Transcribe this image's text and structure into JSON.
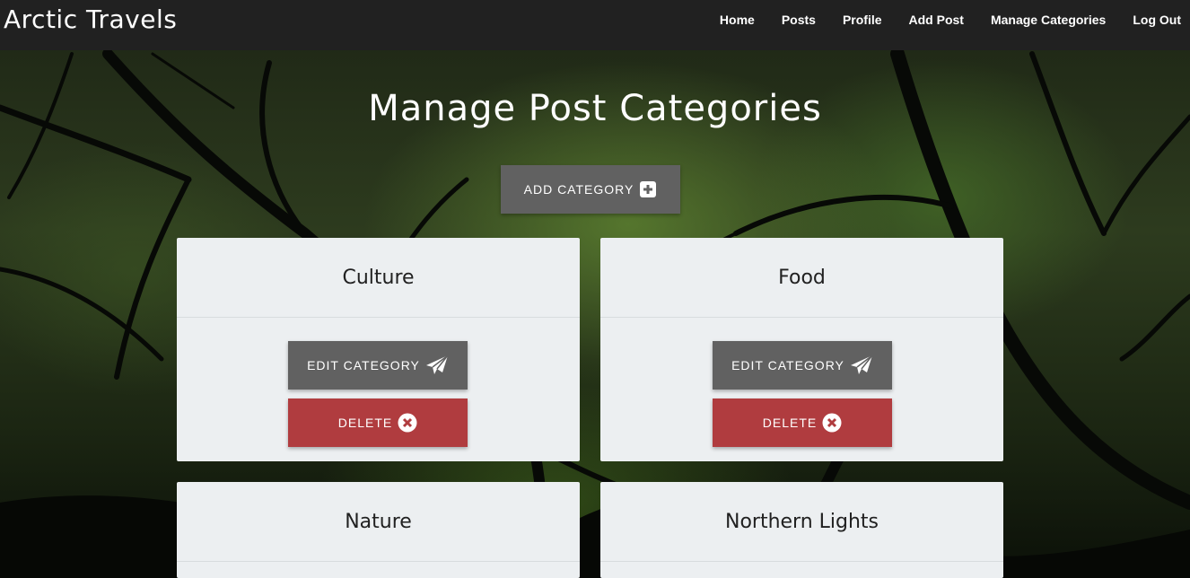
{
  "navbar": {
    "brand": "Arctic Travels",
    "links": [
      "Home",
      "Posts",
      "Profile",
      "Add Post",
      "Manage Categories",
      "Log Out"
    ]
  },
  "page": {
    "title": "Manage Post Categories",
    "add_button": "Add Category"
  },
  "categories": [
    {
      "name": "Culture",
      "edit": "Edit Category",
      "delete": "Delete"
    },
    {
      "name": "Food",
      "edit": "Edit Category",
      "delete": "Delete"
    },
    {
      "name": "Nature"
    },
    {
      "name": "Northern Lights"
    }
  ],
  "colors": {
    "navbar": "#212121",
    "button_grey": "#616161",
    "button_red": "#b03c3f",
    "card": "#eceff1"
  },
  "icons": {
    "add": "plus-square-icon",
    "edit": "paper-plane-icon",
    "delete": "times-circle-icon"
  }
}
